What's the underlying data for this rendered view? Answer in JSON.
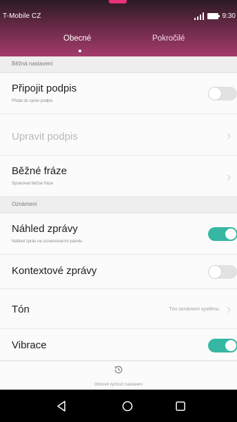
{
  "status_bar": {
    "carrier": "T-Mobile CZ",
    "clock": "9:30"
  },
  "tabs": [
    {
      "label": "Obecné",
      "selected": true
    },
    {
      "label": "Pokročilé",
      "selected": false
    }
  ],
  "sections": {
    "general": "Běžná nastavení",
    "notifications": "Oznámení"
  },
  "settings": {
    "attach_signature": {
      "title": "Připojit podpis",
      "subtitle": "Přidat do zpráv podpis",
      "enabled": false
    },
    "edit_signature": {
      "title": "Upravit podpis",
      "disabled": true
    },
    "quick_phrases": {
      "title": "Běžné fráze",
      "subtitle": "Spravovat běžné fráze"
    },
    "message_preview": {
      "title": "Náhled zprávy",
      "subtitle": "Náhled zpráv na oznamovacím panelu",
      "enabled": true
    },
    "context_messages": {
      "title": "Kontextové zprávy",
      "enabled": false
    },
    "tone": {
      "title": "Tón",
      "value": "Tón oznámení systému"
    },
    "vibration": {
      "title": "Vibrace",
      "enabled": true
    }
  },
  "reset": {
    "label": "Obnovit výchozí nastavení",
    "icon": "history-icon"
  },
  "navigation": {
    "back": "back-triangle-icon",
    "home": "home-circle-icon",
    "recent": "recent-square-icon"
  },
  "colors": {
    "header_dark": "#2b1a24",
    "header_accent": "#a43b6b",
    "toggle_on": "#35b7a3",
    "toggle_off": "#e2e2e2",
    "top_marker": "#e8327a"
  }
}
